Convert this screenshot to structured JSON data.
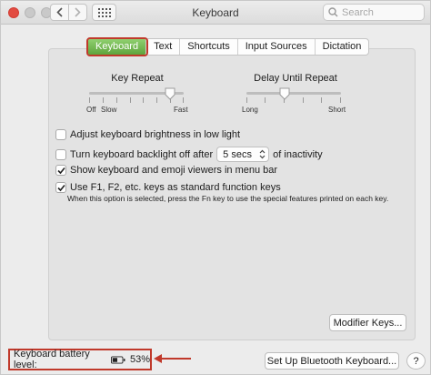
{
  "window": {
    "title": "Keyboard"
  },
  "toolbar": {
    "search_placeholder": "Search"
  },
  "tabs": [
    {
      "label": "Keyboard",
      "active": true
    },
    {
      "label": "Text",
      "active": false
    },
    {
      "label": "Shortcuts",
      "active": false
    },
    {
      "label": "Input Sources",
      "active": false
    },
    {
      "label": "Dictation",
      "active": false
    }
  ],
  "key_repeat": {
    "label": "Key Repeat",
    "tick_labels": {
      "off": "Off",
      "slow": "Slow",
      "fast": "Fast"
    },
    "level": 0.86
  },
  "delay_until_repeat": {
    "label": "Delay Until Repeat",
    "tick_labels": {
      "long": "Long",
      "short": "Short"
    },
    "level": 0.4
  },
  "options": {
    "brightness": {
      "label": "Adjust keyboard brightness in low light",
      "checked": false
    },
    "backlight": {
      "label_before": "Turn keyboard backlight off after",
      "value": "5 secs",
      "label_after": "of inactivity",
      "checked": false
    },
    "viewers": {
      "label": "Show keyboard and emoji viewers in menu bar",
      "checked": true
    },
    "fn_keys": {
      "label": "Use F1, F2, etc. keys as standard function keys",
      "checked": true
    }
  },
  "fn_note": "When this option is selected, press the Fn key to use the special features printed on each key.",
  "buttons": {
    "modifier_keys": "Modifier Keys...",
    "bluetooth": "Set Up Bluetooth Keyboard..."
  },
  "battery": {
    "label": "Keyboard battery level:",
    "percent_text": "53%",
    "level": 0.53
  },
  "colors": {
    "accent_green": "#5ea43c",
    "highlight_red": "#c0392b",
    "checkbox_blue": "#2f7fd9"
  },
  "icons": [
    "chevron-left-icon",
    "chevron-right-icon",
    "grid-icon",
    "search-icon",
    "battery-icon",
    "arrow-left-icon",
    "checkmark-icon"
  ]
}
